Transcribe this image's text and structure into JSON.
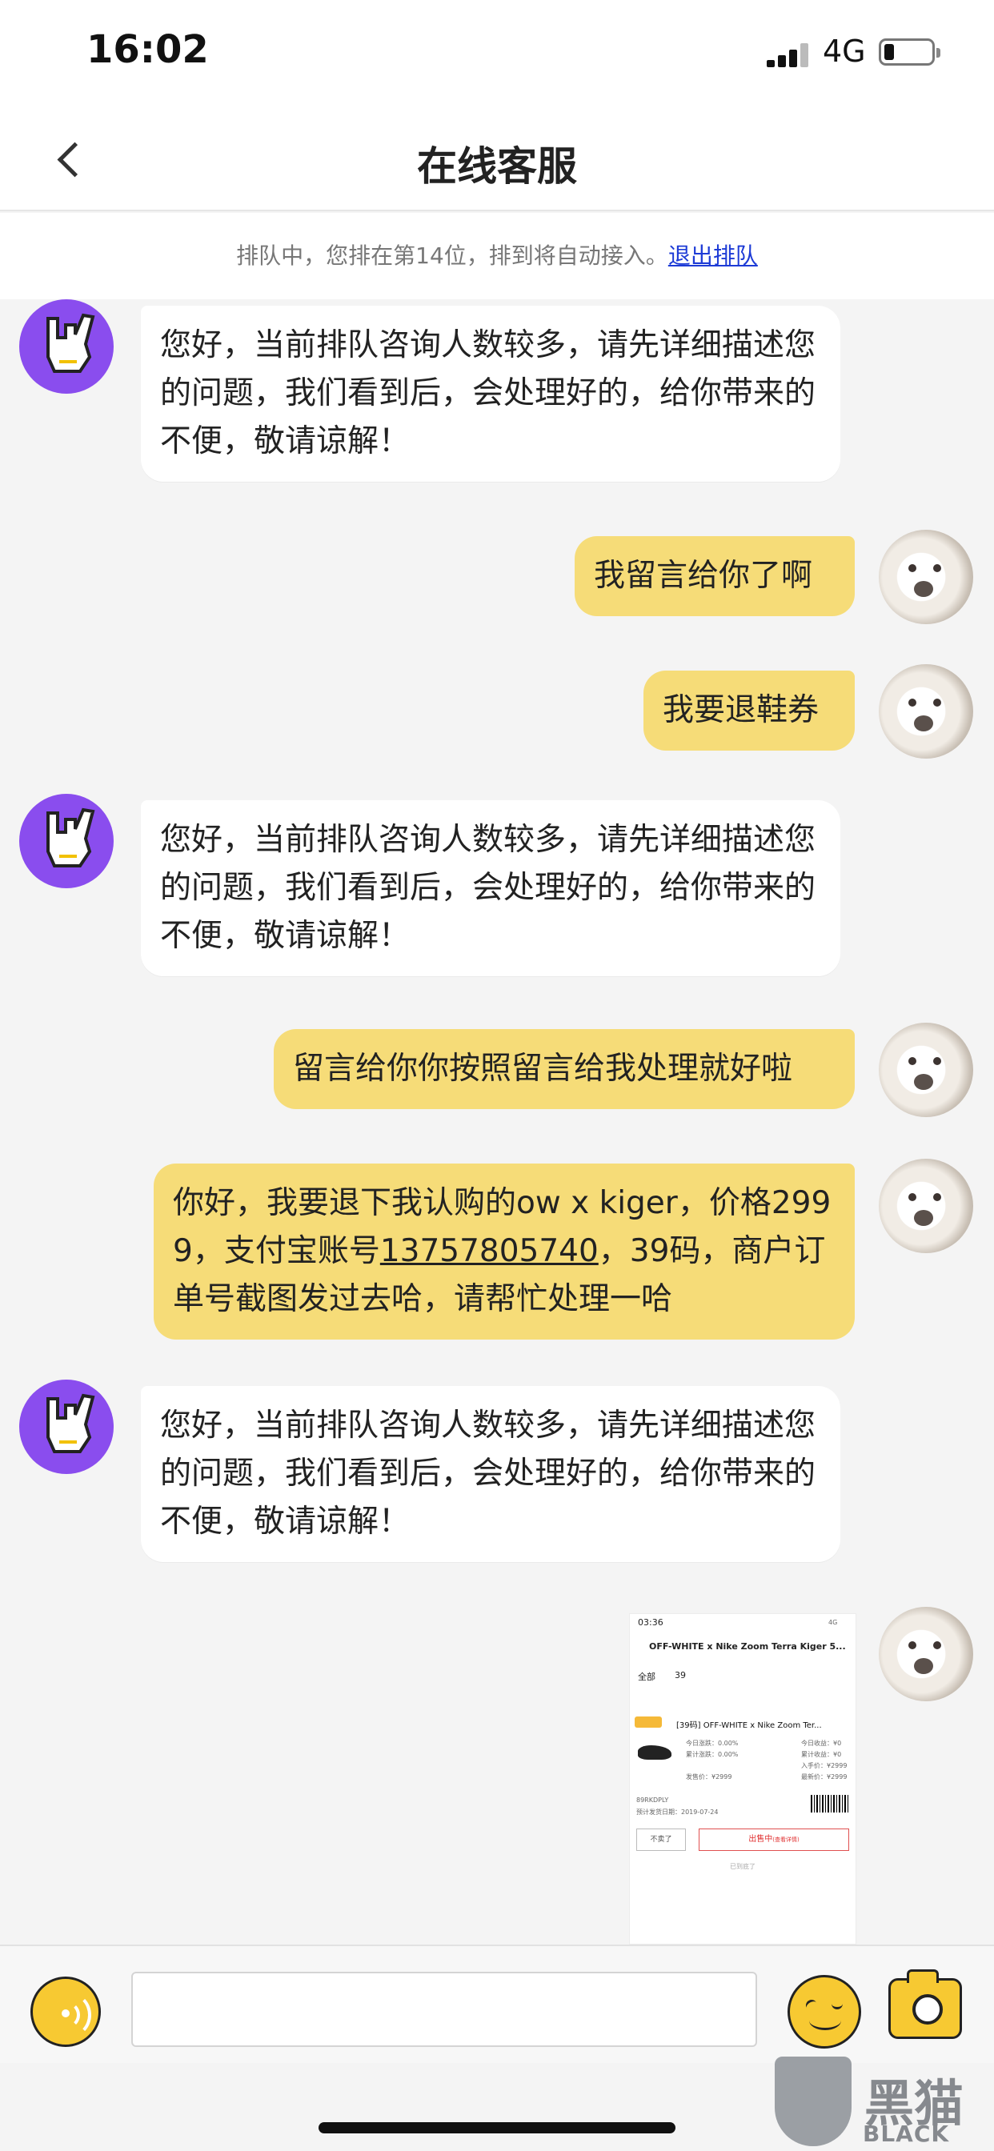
{
  "status_bar": {
    "time": "16:02",
    "network": "4G"
  },
  "nav": {
    "title": "在线客服"
  },
  "queue": {
    "text": "排队中，您排在第14位，排到将自动接入。",
    "exit_link": "退出排队"
  },
  "messages": [
    {
      "sender": "agent",
      "text": "您好，当前排队咨询人数较多，请先详细描述您的问题，我们看到后，会处理好的，给你带来的不便，敬请谅解！"
    },
    {
      "sender": "user",
      "text": "我留言给你了啊"
    },
    {
      "sender": "user",
      "text": "我要退鞋券"
    },
    {
      "sender": "agent",
      "text": "您好，当前排队咨询人数较多，请先详细描述您的问题，我们看到后，会处理好的，给你带来的不便，敬请谅解！"
    },
    {
      "sender": "user",
      "text": "留言给你你按照留言给我处理就好啦"
    },
    {
      "sender": "user",
      "text_parts": [
        "你好，我要退下我认购的ow x kiger，价格2999，支付宝账号",
        "13757805740",
        "，39码，商户订单号截图发过去哈，请帮忙处理一哈"
      ]
    },
    {
      "sender": "agent",
      "text": "您好，当前排队咨询人数较多，请先详细描述您的问题，我们看到后，会处理好的，给你带来的不便，敬请谅解！"
    }
  ],
  "screenshot": {
    "time": "03:36",
    "network": "4G",
    "title": "OFF-WHITE x Nike Zoom Terra Kiger 5...",
    "tab_all": "全部",
    "size": "39",
    "product": "[39码] OFF-WHITE x Nike Zoom Ter...",
    "stats": [
      "今日涨跌：0.00%",
      "累计涨跌：0.00%",
      "今日收益：¥0",
      "累计收益：¥0",
      "入手价：¥2999",
      "发售价：¥2999",
      "最新价：¥2999"
    ],
    "code": "89RKDPLY",
    "date": "预计发货日期：2019-07-24",
    "button_off": "不卖了",
    "button_sell": "出售中",
    "button_sell_note": "(查看详情)",
    "footer": "已到底了"
  },
  "input": {
    "placeholder": ""
  },
  "watermark": {
    "cn": "黑猫",
    "en": "BLACK CAT"
  }
}
